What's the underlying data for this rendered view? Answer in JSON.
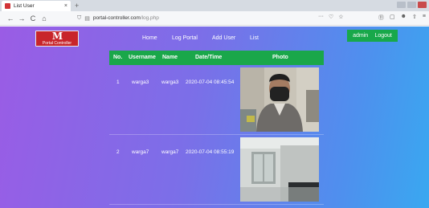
{
  "browser": {
    "tab_title": "List User",
    "tab_close": "×",
    "new_tab": "+",
    "url_domain": "portal-controller.com",
    "url_path": "/log.php",
    "nav": {
      "back": "←",
      "forward": "→",
      "reload": "C",
      "home": "⌂"
    },
    "url_icons": {
      "more": "···",
      "pocket": "♡",
      "bookmark": "☆"
    },
    "tools": [
      "⑪",
      "▢",
      "☻",
      "⇧",
      "≡"
    ]
  },
  "site": {
    "logo_mark": "M",
    "logo_text": "Portal Controller",
    "menu": [
      "Home",
      "Log Portal",
      "Add User",
      "List"
    ],
    "user": "admin",
    "logout": "Logout"
  },
  "table": {
    "headers": [
      "No.",
      "Username",
      "Name",
      "Date/Time",
      "Photo"
    ],
    "rows": [
      {
        "no": "1",
        "username": "warga3",
        "name": "warga3",
        "datetime": "2020-07-04 08:45:54"
      },
      {
        "no": "2",
        "username": "warga7",
        "name": "warga7",
        "datetime": "2020-07-04 08:55:19"
      }
    ]
  },
  "colors": {
    "header_green": "#1aa74a",
    "logo_red": "#c8252b",
    "gradient_start": "#9a5ce5",
    "gradient_end": "#39a8f0"
  }
}
